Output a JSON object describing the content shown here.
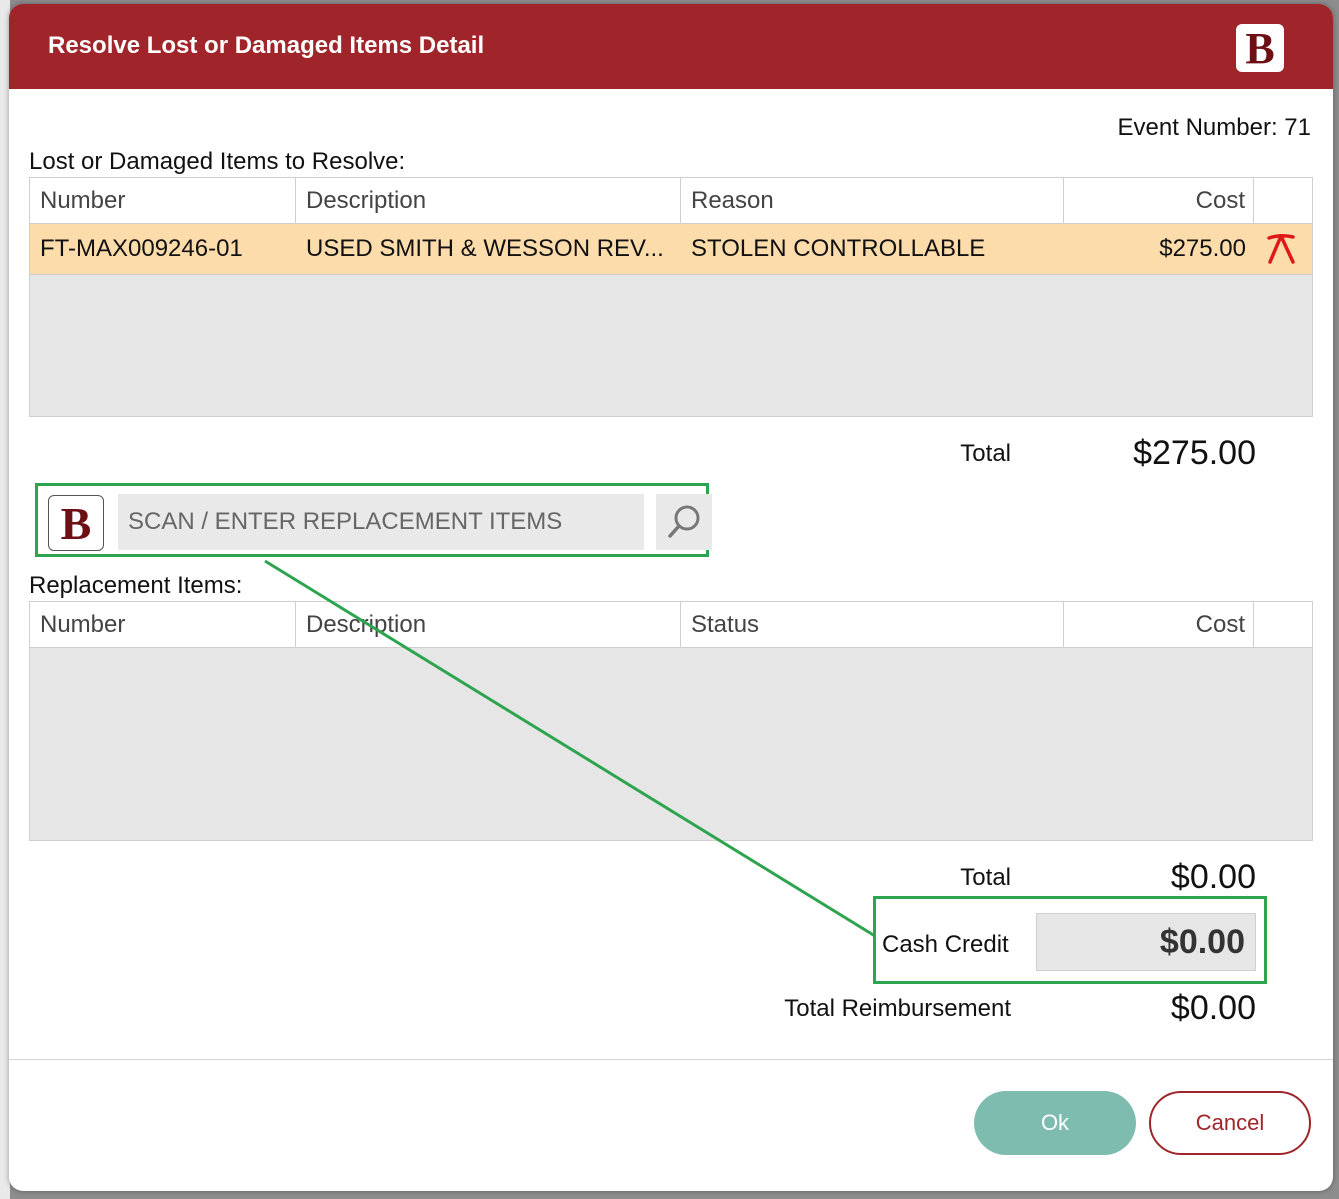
{
  "dialog": {
    "title": "Resolve Lost or Damaged Items Detail",
    "logo_letter": "B",
    "event_label": "Event Number:",
    "event_number": "71"
  },
  "lost_items": {
    "label": "Lost or Damaged Items to Resolve:",
    "columns": [
      "Number",
      "Description",
      "Reason",
      "Cost"
    ],
    "rows": [
      {
        "number": "FT-MAX009246-01",
        "description": "USED SMITH & WESSON REV...",
        "reason": "STOLEN CONTROLLABLE",
        "cost": "$275.00",
        "remove_icon": "remove-x-icon"
      }
    ],
    "total_label": "Total",
    "total_value": "$275.00"
  },
  "scan": {
    "placeholder": "SCAN / ENTER REPLACEMENT ITEMS",
    "search_icon": "search-icon"
  },
  "replacement_items": {
    "label": "Replacement Items:",
    "columns": [
      "Number",
      "Description",
      "Status",
      "Cost"
    ],
    "rows": [],
    "total_label": "Total",
    "total_value": "$0.00"
  },
  "cash_credit": {
    "label": "Cash Credit",
    "value": "$0.00"
  },
  "reimbursement": {
    "label": "Total Reimbursement",
    "value": "$0.00"
  },
  "buttons": {
    "ok": "Ok",
    "cancel": "Cancel"
  },
  "colors": {
    "header": "#a0252a",
    "selected_row": "#fddcac",
    "highlight_box": "#2ea44f",
    "ok_button": "#7fbcb0"
  }
}
